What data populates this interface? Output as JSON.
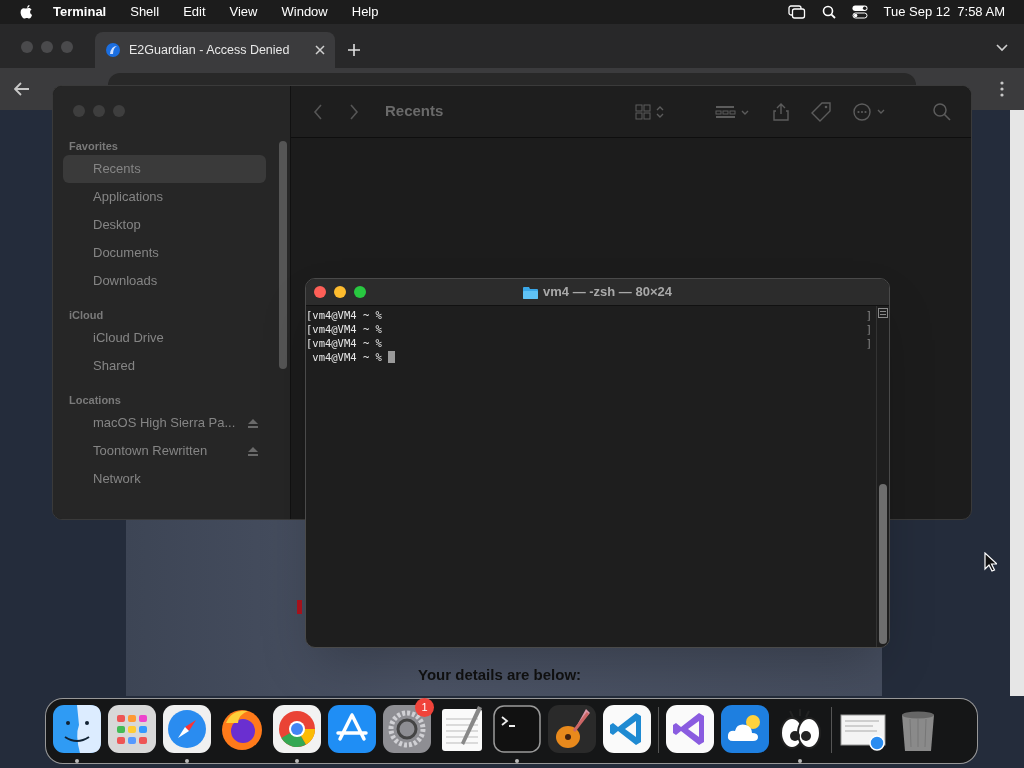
{
  "menu_bar": {
    "app": "Terminal",
    "menus": [
      "Shell",
      "Edit",
      "View",
      "Window",
      "Help"
    ],
    "date": "Tue Sep 12",
    "time": "7:58 AM"
  },
  "browser": {
    "tabs": [
      {
        "title": "E2Guardian - Access Denied",
        "selected": true
      }
    ],
    "page": {
      "heading": "Your details are below:"
    }
  },
  "finder": {
    "title": "Recents",
    "sidebar": [
      {
        "heading": "Favorites",
        "items": [
          {
            "label": "Recents",
            "selected": true,
            "eject": false
          },
          {
            "label": "Applications",
            "selected": false,
            "eject": false
          },
          {
            "label": "Desktop",
            "selected": false,
            "eject": false
          },
          {
            "label": "Documents",
            "selected": false,
            "eject": false
          },
          {
            "label": "Downloads",
            "selected": false,
            "eject": false
          }
        ]
      },
      {
        "heading": "iCloud",
        "items": [
          {
            "label": "iCloud Drive",
            "selected": false,
            "eject": false
          },
          {
            "label": "Shared",
            "selected": false,
            "eject": false
          }
        ]
      },
      {
        "heading": "Locations",
        "items": [
          {
            "label": "macOS High Sierra Pa...",
            "selected": false,
            "eject": true
          },
          {
            "label": "Toontown Rewritten",
            "selected": false,
            "eject": true
          },
          {
            "label": "Network",
            "selected": false,
            "eject": false
          }
        ]
      }
    ]
  },
  "terminal": {
    "title": "vm4 — -zsh — 80×24",
    "lines": [
      {
        "text": "[vm4@VM4 ~ %",
        "end_mark": "]",
        "cursor": false
      },
      {
        "text": "[vm4@VM4 ~ %",
        "end_mark": "]",
        "cursor": false
      },
      {
        "text": "[vm4@VM4 ~ %",
        "end_mark": "]",
        "cursor": false
      },
      {
        "text": " vm4@VM4 ~ %",
        "cursor": true
      }
    ]
  },
  "dock": {
    "groups": [
      [
        {
          "kind": "finder",
          "running": true
        },
        {
          "kind": "launchpad",
          "running": false
        },
        {
          "kind": "safari",
          "running": true
        },
        {
          "kind": "firefox",
          "running": false
        },
        {
          "kind": "chrome",
          "running": true
        },
        {
          "kind": "appstore",
          "running": false
        },
        {
          "kind": "settings",
          "running": false,
          "badge": "1"
        },
        {
          "kind": "textedit",
          "running": false
        },
        {
          "kind": "terminal",
          "running": true
        },
        {
          "kind": "guitar",
          "running": false
        },
        {
          "kind": "vscode",
          "running": false
        }
      ],
      [
        {
          "kind": "visualstudio",
          "running": false
        },
        {
          "kind": "weather",
          "running": false
        },
        {
          "kind": "eyes",
          "running": true
        }
      ],
      [
        {
          "kind": "document",
          "running": false
        },
        {
          "kind": "trash",
          "running": false
        }
      ]
    ]
  }
}
